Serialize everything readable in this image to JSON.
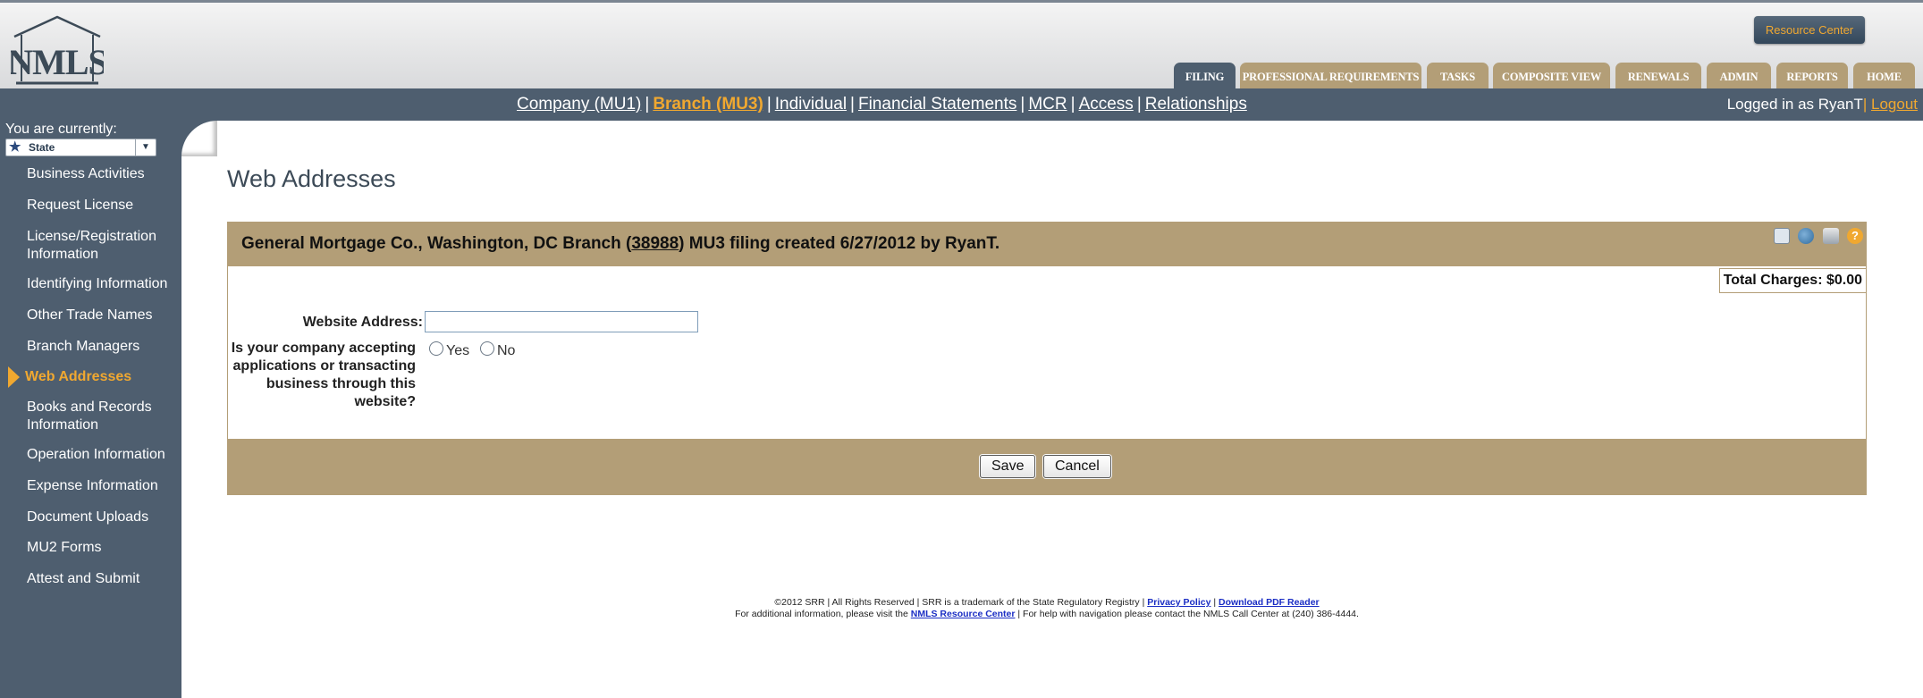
{
  "header": {
    "logo_text": "NMLS",
    "resource_center": "Resource Center",
    "tabs": [
      {
        "label": "FILING",
        "active": true
      },
      {
        "label": "PROFESSIONAL REQUIREMENTS",
        "active": false
      },
      {
        "label": "TASKS",
        "active": false
      },
      {
        "label": "COMPOSITE VIEW",
        "active": false
      },
      {
        "label": "RENEWALS",
        "active": false
      },
      {
        "label": "ADMIN",
        "active": false
      },
      {
        "label": "REPORTS",
        "active": false
      },
      {
        "label": "HOME",
        "active": false
      }
    ]
  },
  "navbar": {
    "links": [
      {
        "label": "Company (MU1)",
        "active": false
      },
      {
        "label": "Branch (MU3)",
        "active": true
      },
      {
        "label": "Individual",
        "active": false
      },
      {
        "label": "Financial Statements",
        "active": false
      },
      {
        "label": "MCR",
        "active": false
      },
      {
        "label": "Access",
        "active": false
      },
      {
        "label": "Relationships",
        "active": false
      }
    ],
    "separator": "|",
    "logged_in_text": "Logged in as RyanT",
    "logout": "Logout"
  },
  "sidebar": {
    "currently_label": "You are currently:",
    "state_value": "State",
    "items": [
      {
        "label": "Business Activities",
        "active": false
      },
      {
        "label": "Request License",
        "active": false
      },
      {
        "label": "License/Registration Information",
        "active": false
      },
      {
        "label": "Identifying Information",
        "active": false
      },
      {
        "label": "Other Trade Names",
        "active": false
      },
      {
        "label": "Branch Managers",
        "active": false
      },
      {
        "label": "Web Addresses",
        "active": true
      },
      {
        "label": "Books and Records Information",
        "active": false
      },
      {
        "label": "Operation Information",
        "active": false
      },
      {
        "label": "Expense Information",
        "active": false
      },
      {
        "label": "Document Uploads",
        "active": false
      },
      {
        "label": "MU2 Forms",
        "active": false
      },
      {
        "label": "Attest and Submit",
        "active": false
      }
    ]
  },
  "main": {
    "page_title": "Web Addresses",
    "panel": {
      "title_prefix": "General Mortgage Co., Washington, DC Branch (",
      "branch_id": "38988",
      "title_suffix": ") MU3 filing created 6/27/2012 by RyanT.",
      "icons": [
        "expand-icon",
        "globe-icon",
        "print-icon",
        "help-icon"
      ],
      "total_charges": "Total Charges: $0.00",
      "website_label": "Website Address:",
      "website_value": "",
      "question": "Is your company accepting applications or transacting business through this website?",
      "yes_label": "Yes",
      "no_label": "No",
      "save_label": "Save",
      "cancel_label": "Cancel"
    }
  },
  "footer": {
    "line1": "©2012 SRR | All Rights Reserved | SRR is a trademark of the State Regulatory Registry |",
    "privacy": "Privacy Policy",
    "pdf": "Download PDF Reader",
    "line2_prefix": "For additional information, please visit the",
    "resource_center": "NMLS Resource Center",
    "line2_suffix": "| For help with navigation please contact the NMLS Call Center at (240) 386-4444."
  },
  "colors": {
    "nav_blue": "#4e5e6f",
    "tan": "#b39e77",
    "accent_orange": "#f0a830"
  }
}
